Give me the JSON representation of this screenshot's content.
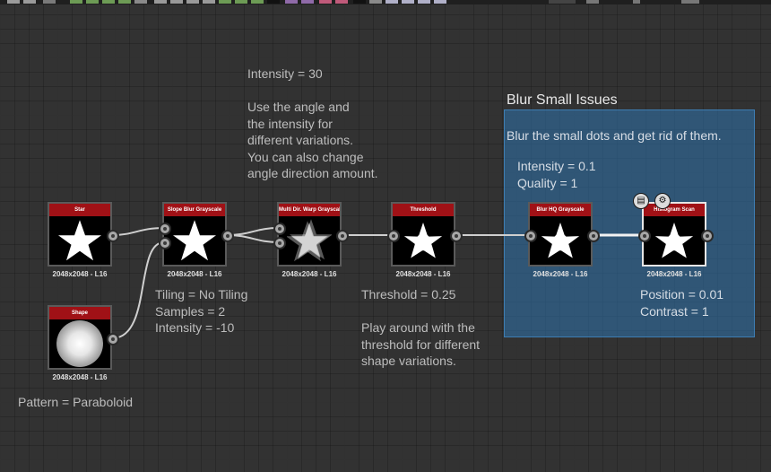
{
  "canvas": {
    "background": "#323232",
    "wire_color": "#cfcfcf",
    "node_title_color": "#a01116",
    "frame_color": "#2e6ca0"
  },
  "nodes": [
    {
      "id": "star",
      "title": "Star",
      "resolution": "2048x2048 - L16",
      "preview": "star-icon"
    },
    {
      "id": "shape",
      "title": "Shape",
      "resolution": "2048x2048 - L16",
      "preview": "paraboloid-icon"
    },
    {
      "id": "slope_blur",
      "title": "Slope Blur Grayscale",
      "resolution": "2048x2048 - L16",
      "preview": "star-icon"
    },
    {
      "id": "multi_warp",
      "title": "Multi Dir. Warp Grayscale",
      "resolution": "2048x2048 - L16",
      "preview": "blurred-star-icon"
    },
    {
      "id": "threshold",
      "title": "Threshold",
      "resolution": "2048x2048 - L16",
      "preview": "rough-star-icon"
    },
    {
      "id": "blur_hq",
      "title": "Blur HQ Grayscale",
      "resolution": "2048x2048 - L16",
      "preview": "rough-star-icon"
    },
    {
      "id": "histogram_scan",
      "title": "Histogram Scan",
      "resolution": "2048x2048 - L16",
      "preview": "rough-star-icon",
      "selected": true
    }
  ],
  "comments": {
    "pattern": "Pattern = Paraboloid",
    "slope_blur": "Tiling = No Tiling\nSamples = 2\nIntensity = -10",
    "warp": "Intensity = 30\n\nUse the angle and\nthe intensity for\ndifferent variations.\nYou can also change\nangle direction amount.",
    "threshold": "Threshold = 0.25\n\nPlay around with the\nthreshold for different\nshape variations.",
    "blur": "Intensity = 0.1\nQuality = 1",
    "histogram": "Position = 0.01\nContrast = 1"
  },
  "frame": {
    "title": "Blur Small Issues",
    "description": "Blur the small dots and get rid of them."
  },
  "badges": [
    "document-icon",
    "gear-icon"
  ]
}
